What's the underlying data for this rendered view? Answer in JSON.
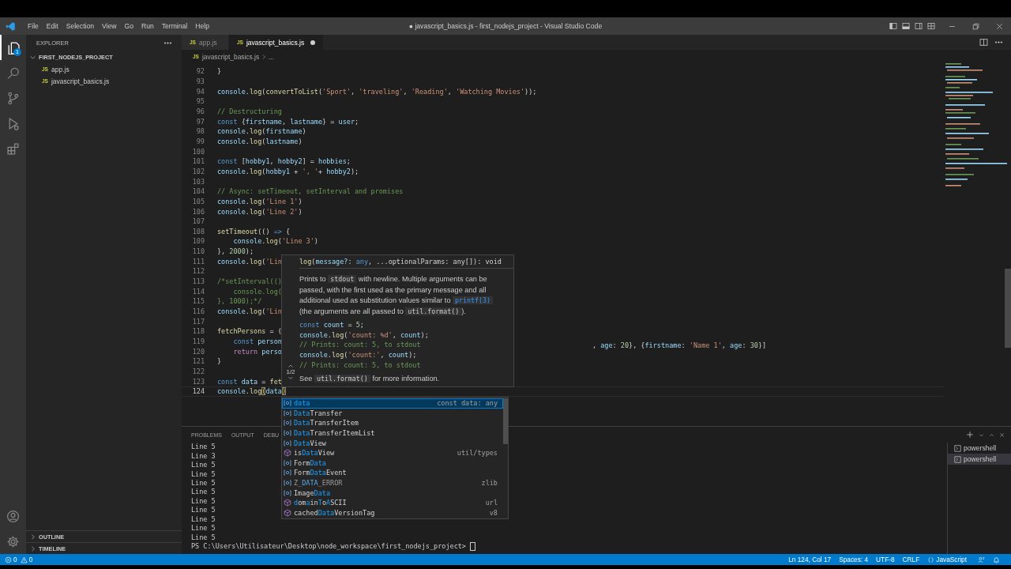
{
  "title_bar": {
    "menus": [
      "File",
      "Edit",
      "Selection",
      "View",
      "Go",
      "Run",
      "Terminal",
      "Help"
    ],
    "title": "● javascript_basics.js - first_nodejs_project - Visual Studio Code"
  },
  "activity_bar": {
    "items": [
      {
        "kind": "explorer",
        "selected": true,
        "badge": "1"
      },
      {
        "kind": "search",
        "selected": false
      },
      {
        "kind": "source-control",
        "selected": false
      },
      {
        "kind": "run-debug",
        "selected": false
      },
      {
        "kind": "extensions",
        "selected": false
      }
    ],
    "bottom": [
      {
        "kind": "account",
        "selected": false
      },
      {
        "kind": "manage",
        "selected": false
      }
    ]
  },
  "sidebar": {
    "title": "EXPLORER",
    "folder": {
      "name": "FIRST_NODEJS_PROJECT",
      "expanded": true
    },
    "files": [
      {
        "badge": "JS",
        "name": "app.js"
      },
      {
        "badge": "JS",
        "name": "javascript_basics.js"
      }
    ],
    "sections": [
      {
        "label": "OUTLINE",
        "expanded": false
      },
      {
        "label": "TIMELINE",
        "expanded": false
      }
    ]
  },
  "tabs": [
    {
      "badge": "JS",
      "label": "app.js",
      "selected": false,
      "dirty": false
    },
    {
      "badge": "JS",
      "label": "javascript_basics.js",
      "selected": true,
      "dirty": true
    }
  ],
  "breadcrumb": {
    "badge": "JS",
    "file": "javascript_basics.js",
    "rest": "..."
  },
  "code_lines": [
    {
      "number": "92",
      "current": false,
      "tokens": [
        {
          "kind": "txt",
          "text": "}"
        }
      ]
    },
    {
      "number": "93",
      "current": false
    },
    {
      "number": "94",
      "current": false,
      "tokens": [
        {
          "kind": "var",
          "text": "console"
        },
        {
          "kind": "txt",
          "text": "."
        },
        {
          "kind": "fn",
          "text": "log"
        },
        {
          "kind": "txt",
          "text": "("
        },
        {
          "kind": "fn",
          "text": "convertToList"
        },
        {
          "kind": "txt",
          "text": "("
        },
        {
          "kind": "str",
          "text": "'Sport'"
        },
        {
          "kind": "txt",
          "text": ", "
        },
        {
          "kind": "str",
          "text": "'traveling'"
        },
        {
          "kind": "txt",
          "text": ", "
        },
        {
          "kind": "str",
          "text": "'Reading'"
        },
        {
          "kind": "txt",
          "text": ", "
        },
        {
          "kind": "str",
          "text": "'Watching Movies'"
        },
        {
          "kind": "txt",
          "text": "));"
        }
      ]
    },
    {
      "number": "95",
      "current": false
    },
    {
      "number": "96",
      "current": false,
      "tokens": [
        {
          "kind": "cmt",
          "text": "// Destructuring"
        }
      ]
    },
    {
      "number": "97",
      "current": false,
      "tokens": [
        {
          "kind": "kw",
          "text": "const"
        },
        {
          "kind": "txt",
          "text": " {"
        },
        {
          "kind": "var",
          "text": "firstname"
        },
        {
          "kind": "txt",
          "text": ", "
        },
        {
          "kind": "var",
          "text": "lastname"
        },
        {
          "kind": "txt",
          "text": "} = "
        },
        {
          "kind": "var",
          "text": "user"
        },
        {
          "kind": "txt",
          "text": ";"
        }
      ]
    },
    {
      "number": "98",
      "current": false,
      "tokens": [
        {
          "kind": "var",
          "text": "console"
        },
        {
          "kind": "txt",
          "text": "."
        },
        {
          "kind": "fn",
          "text": "log"
        },
        {
          "kind": "txt",
          "text": "("
        },
        {
          "kind": "var",
          "text": "firstname"
        },
        {
          "kind": "txt",
          "text": ")"
        }
      ]
    },
    {
      "number": "99",
      "current": false,
      "tokens": [
        {
          "kind": "var",
          "text": "console"
        },
        {
          "kind": "txt",
          "text": "."
        },
        {
          "kind": "fn",
          "text": "log"
        },
        {
          "kind": "txt",
          "text": "("
        },
        {
          "kind": "var",
          "text": "lastname"
        },
        {
          "kind": "txt",
          "text": ")"
        }
      ]
    },
    {
      "number": "100",
      "current": false
    },
    {
      "number": "101",
      "current": false,
      "tokens": [
        {
          "kind": "kw",
          "text": "const"
        },
        {
          "kind": "txt",
          "text": " ["
        },
        {
          "kind": "var",
          "text": "hobby1"
        },
        {
          "kind": "txt",
          "text": ", "
        },
        {
          "kind": "var",
          "text": "hobby2"
        },
        {
          "kind": "txt",
          "text": "] = "
        },
        {
          "kind": "var",
          "text": "hobbies"
        },
        {
          "kind": "txt",
          "text": ";"
        }
      ]
    },
    {
      "number": "102",
      "current": false,
      "tokens": [
        {
          "kind": "var",
          "text": "console"
        },
        {
          "kind": "txt",
          "text": "."
        },
        {
          "kind": "fn",
          "text": "log"
        },
        {
          "kind": "txt",
          "text": "("
        },
        {
          "kind": "var",
          "text": "hobby1"
        },
        {
          "kind": "txt",
          "text": " + "
        },
        {
          "kind": "str",
          "text": "', '"
        },
        {
          "kind": "txt",
          "text": "+ "
        },
        {
          "kind": "var",
          "text": "hobby2"
        },
        {
          "kind": "txt",
          "text": ");"
        }
      ]
    },
    {
      "number": "103",
      "current": false
    },
    {
      "number": "104",
      "current": false,
      "tokens": [
        {
          "kind": "cmt",
          "text": "// Async: setTimeout, setInterval and promises"
        }
      ]
    },
    {
      "number": "105",
      "current": false,
      "tokens": [
        {
          "kind": "var",
          "text": "console"
        },
        {
          "kind": "txt",
          "text": "."
        },
        {
          "kind": "fn",
          "text": "log"
        },
        {
          "kind": "txt",
          "text": "("
        },
        {
          "kind": "str",
          "text": "'Line 1'"
        },
        {
          "kind": "txt",
          "text": ")"
        }
      ]
    },
    {
      "number": "106",
      "current": false,
      "tokens": [
        {
          "kind": "var",
          "text": "console"
        },
        {
          "kind": "txt",
          "text": "."
        },
        {
          "kind": "fn",
          "text": "log"
        },
        {
          "kind": "txt",
          "text": "("
        },
        {
          "kind": "str",
          "text": "'Line 2'"
        },
        {
          "kind": "txt",
          "text": ")"
        }
      ]
    },
    {
      "number": "107",
      "current": false
    },
    {
      "number": "108",
      "current": false,
      "tokens": [
        {
          "kind": "fn",
          "text": "setTimeout"
        },
        {
          "kind": "txt",
          "text": "(() "
        },
        {
          "kind": "kw",
          "text": "=>"
        },
        {
          "kind": "txt",
          "text": " {"
        }
      ]
    },
    {
      "number": "109",
      "current": false,
      "indented": true,
      "tokens": [
        {
          "kind": "var",
          "text": "console"
        },
        {
          "kind": "txt",
          "text": "."
        },
        {
          "kind": "fn",
          "text": "log"
        },
        {
          "kind": "txt",
          "text": "("
        },
        {
          "kind": "str",
          "text": "'Line 3'"
        },
        {
          "kind": "txt",
          "text": ")"
        }
      ]
    },
    {
      "number": "110",
      "current": false,
      "tokens": [
        {
          "kind": "txt",
          "text": "}, "
        },
        {
          "kind": "num",
          "text": "2000"
        },
        {
          "kind": "txt",
          "text": ");"
        }
      ]
    },
    {
      "number": "111",
      "current": false,
      "tokens": [
        {
          "kind": "var",
          "text": "console"
        },
        {
          "kind": "txt",
          "text": "."
        },
        {
          "kind": "fn",
          "text": "log"
        },
        {
          "kind": "txt",
          "text": "("
        },
        {
          "kind": "str",
          "text": "'Lin"
        }
      ]
    },
    {
      "number": "112",
      "current": false
    },
    {
      "number": "113",
      "current": false,
      "tokens": [
        {
          "kind": "cmt",
          "text": "/*setInterval(()"
        }
      ]
    },
    {
      "number": "114",
      "current": false,
      "tokens": [
        {
          "kind": "cmt",
          "text": "    console.log("
        }
      ]
    },
    {
      "number": "115",
      "current": false,
      "tokens": [
        {
          "kind": "cmt",
          "text": "}, 1000);*/"
        }
      ]
    },
    {
      "number": "116",
      "current": false,
      "tokens": [
        {
          "kind": "var",
          "text": "console"
        },
        {
          "kind": "txt",
          "text": "."
        },
        {
          "kind": "fn",
          "text": "log"
        },
        {
          "kind": "txt",
          "text": "("
        },
        {
          "kind": "str",
          "text": "'Lin"
        }
      ]
    },
    {
      "number": "117",
      "current": false
    },
    {
      "number": "118",
      "current": false,
      "tokens": [
        {
          "kind": "fn",
          "text": "fetchPersons"
        },
        {
          "kind": "txt",
          "text": " = ("
        }
      ]
    },
    {
      "number": "119",
      "current": false,
      "indented": true,
      "tokens": [
        {
          "kind": "kw",
          "text": "const "
        },
        {
          "kind": "var",
          "text": "person"
        }
      ],
      "tail": [
        {
          "kind": "txt",
          "text": ", "
        },
        {
          "kind": "var",
          "text": "age"
        },
        {
          "kind": "txt",
          "text": ": "
        },
        {
          "kind": "num",
          "text": "20"
        },
        {
          "kind": "txt",
          "text": "}, {"
        },
        {
          "kind": "var",
          "text": "firstname"
        },
        {
          "kind": "txt",
          "text": ": "
        },
        {
          "kind": "str",
          "text": "'Name 1'"
        },
        {
          "kind": "txt",
          "text": ", "
        },
        {
          "kind": "var",
          "text": "age"
        },
        {
          "kind": "txt",
          "text": ": "
        },
        {
          "kind": "num",
          "text": "30"
        },
        {
          "kind": "txt",
          "text": "}]"
        }
      ]
    },
    {
      "number": "120",
      "current": false,
      "indented": true,
      "tokens": [
        {
          "kind": "ctl",
          "text": "return "
        },
        {
          "kind": "var",
          "text": "perso"
        }
      ]
    },
    {
      "number": "121",
      "current": false,
      "tokens": [
        {
          "kind": "txt",
          "text": "}"
        }
      ]
    },
    {
      "number": "122",
      "current": false
    },
    {
      "number": "123",
      "current": false,
      "tokens": [
        {
          "kind": "kw",
          "text": "const "
        },
        {
          "kind": "var",
          "text": "data"
        },
        {
          "kind": "txt",
          "text": " = "
        },
        {
          "kind": "fn",
          "text": "fet"
        }
      ]
    },
    {
      "number": "124",
      "current": true,
      "tokens": [
        {
          "kind": "var",
          "text": "console"
        },
        {
          "kind": "txt",
          "text": "."
        },
        {
          "kind": "fn",
          "text": "log"
        },
        {
          "kind": "brk",
          "text": "("
        },
        {
          "kind": "var",
          "text": "data"
        },
        {
          "kind": "brk",
          "text": ")"
        }
      ]
    }
  ],
  "hover": {
    "signature": [
      {
        "kind": "fn",
        "text": "log"
      },
      {
        "kind": "txt",
        "text": "("
      },
      {
        "kind": "var",
        "text": "message?"
      },
      {
        "kind": "txt",
        "text": ": "
      },
      {
        "kind": "kw",
        "text": "any"
      },
      {
        "kind": "txt",
        "text": ", ...optionalParams: any[]): void"
      }
    ],
    "description": [
      {
        "kind": "txt",
        "text": "Prints to "
      },
      {
        "kind": "code",
        "text": "stdout"
      },
      {
        "kind": "txt",
        "text": " with newline. Multiple arguments can be passed, with the first used as the primary message and all additional used as substitution values similar to "
      },
      {
        "kind": "link",
        "text": "printf(3)"
      },
      {
        "kind": "txt",
        "text": " (the arguments are all passed to "
      },
      {
        "kind": "code",
        "text": "util.format()"
      },
      {
        "kind": "txt",
        "text": ")."
      }
    ],
    "example": [
      [
        {
          "kind": "kw",
          "text": "const "
        },
        {
          "kind": "var",
          "text": "count"
        },
        {
          "kind": "txt",
          "text": " = "
        },
        {
          "kind": "num",
          "text": "5"
        },
        {
          "kind": "txt",
          "text": ";"
        }
      ],
      [
        {
          "kind": "var",
          "text": "console"
        },
        {
          "kind": "txt",
          "text": "."
        },
        {
          "kind": "fn",
          "text": "log"
        },
        {
          "kind": "txt",
          "text": "("
        },
        {
          "kind": "str",
          "text": "'count: %d'"
        },
        {
          "kind": "txt",
          "text": ", "
        },
        {
          "kind": "var",
          "text": "count"
        },
        {
          "kind": "txt",
          "text": ");"
        }
      ],
      [
        {
          "kind": "cmt",
          "text": "// Prints: count: 5, to stdout"
        }
      ],
      [
        {
          "kind": "var",
          "text": "console"
        },
        {
          "kind": "txt",
          "text": "."
        },
        {
          "kind": "fn",
          "text": "log"
        },
        {
          "kind": "txt",
          "text": "("
        },
        {
          "kind": "str",
          "text": "'count:'"
        },
        {
          "kind": "txt",
          "text": ", "
        },
        {
          "kind": "var",
          "text": "count"
        },
        {
          "kind": "txt",
          "text": ");"
        }
      ],
      [
        {
          "kind": "cmt",
          "text": "// Prints: count: 5, to stdout"
        }
      ]
    ],
    "footer": [
      {
        "kind": "txt",
        "text": "See "
      },
      {
        "kind": "code",
        "text": "util.format()"
      },
      {
        "kind": "txt",
        "text": " for more information."
      }
    ],
    "pager": "1/2"
  },
  "suggestions": [
    {
      "kind": "variable",
      "selected": true,
      "deprecated": false,
      "parts": [
        {
          "text": "data",
          "match": true
        }
      ],
      "detail": "const data: any"
    },
    {
      "kind": "variable",
      "selected": false,
      "deprecated": false,
      "parts": [
        {
          "text": "Data",
          "match": true
        },
        {
          "text": "Transfer",
          "match": false
        }
      ]
    },
    {
      "kind": "variable",
      "selected": false,
      "deprecated": false,
      "parts": [
        {
          "text": "Data",
          "match": true
        },
        {
          "text": "TransferItem",
          "match": false
        }
      ]
    },
    {
      "kind": "variable",
      "selected": false,
      "deprecated": false,
      "parts": [
        {
          "text": "Data",
          "match": true
        },
        {
          "text": "TransferItemList",
          "match": false
        }
      ]
    },
    {
      "kind": "variable",
      "selected": false,
      "deprecated": false,
      "parts": [
        {
          "text": "Data",
          "match": true
        },
        {
          "text": "View",
          "match": false
        }
      ]
    },
    {
      "kind": "module",
      "selected": false,
      "deprecated": false,
      "parts": [
        {
          "text": "is",
          "match": false
        },
        {
          "text": "Data",
          "match": true
        },
        {
          "text": "View",
          "match": false
        }
      ],
      "detail": "util/types"
    },
    {
      "kind": "variable",
      "selected": false,
      "deprecated": false,
      "parts": [
        {
          "text": "Form",
          "match": false
        },
        {
          "text": "Data",
          "match": true
        }
      ]
    },
    {
      "kind": "variable",
      "selected": false,
      "deprecated": false,
      "parts": [
        {
          "text": "Form",
          "match": false
        },
        {
          "text": "Data",
          "match": true
        },
        {
          "text": "Event",
          "match": false
        }
      ]
    },
    {
      "kind": "variable",
      "selected": false,
      "deprecated": true,
      "parts": [
        {
          "text": "Z_",
          "match": false
        },
        {
          "text": "DATA",
          "match": true
        },
        {
          "text": "_ERROR",
          "match": false
        }
      ],
      "detail": "zlib"
    },
    {
      "kind": "variable",
      "selected": false,
      "deprecated": false,
      "parts": [
        {
          "text": "Image",
          "match": false
        },
        {
          "text": "Data",
          "match": true
        }
      ]
    },
    {
      "kind": "module",
      "selected": false,
      "deprecated": false,
      "parts": [
        {
          "text": "d",
          "match": true
        },
        {
          "text": "om",
          "match": false
        },
        {
          "text": "a",
          "match": true
        },
        {
          "text": "in",
          "match": false
        },
        {
          "text": "T",
          "match": true
        },
        {
          "text": "o",
          "match": false
        },
        {
          "text": "A",
          "match": true
        },
        {
          "text": "SCII",
          "match": false
        }
      ],
      "detail": "url"
    },
    {
      "kind": "module",
      "selected": false,
      "deprecated": false,
      "parts": [
        {
          "text": "cached",
          "match": false
        },
        {
          "text": "Data",
          "match": true
        },
        {
          "text": "VersionTag",
          "match": false
        }
      ],
      "detail": "v8"
    }
  ],
  "panel": {
    "tabs": [
      {
        "label": "PROBLEMS",
        "selected": false
      },
      {
        "label": "OUTPUT",
        "selected": false
      },
      {
        "label": "DEBU",
        "selected": false
      }
    ],
    "terminal_lines": [
      "Line 5",
      "Line 3",
      "Line 5",
      "Line 5",
      "Line 5",
      "Line 5",
      "Line 5",
      "Line 5",
      "Line 5",
      "Line 5",
      "Line 5"
    ],
    "prompt": "PS C:\\Users\\Utilisateur\\Desktop\\node_workspace\\first_nodejs_project> ",
    "terminals": [
      {
        "label": "powershell",
        "selected": false
      },
      {
        "label": "powershell",
        "selected": true
      }
    ]
  },
  "status_bar": {
    "errors": "0",
    "warnings": "0",
    "items": [
      "Ln 124, Col 17",
      "Spaces: 4",
      "UTF-8",
      "CRLF"
    ],
    "language": "JavaScript"
  }
}
